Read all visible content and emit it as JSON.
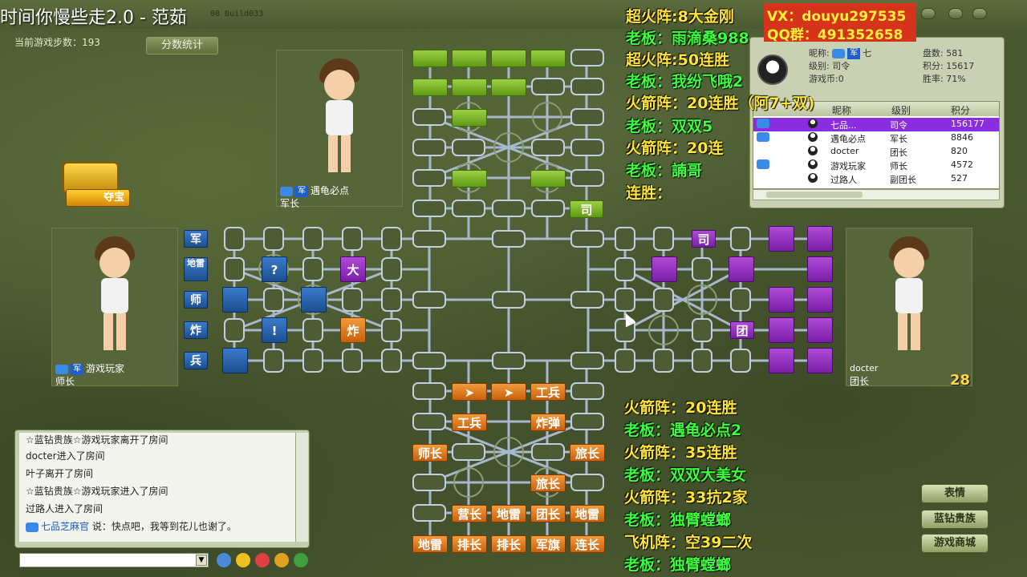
{
  "window": {
    "caption": "时间你慢些走2.0 - 范茹",
    "build": "08 Build033"
  },
  "game": {
    "steps_label": "当前游戏步数：193",
    "stats_button": "分数统计",
    "treasure_label": "夺宝",
    "countdown": "28"
  },
  "players": {
    "top": {
      "name": "遇龟必点",
      "rank": "军长",
      "army": "军"
    },
    "left": {
      "name": "游戏玩家",
      "rank": "师长",
      "army": "军"
    },
    "right": {
      "name": "docter",
      "rank": "团长"
    }
  },
  "board": {
    "left_pieces": [
      "军",
      "地雷",
      "师",
      "炸",
      "兵",
      "?",
      "大",
      "!",
      "炸"
    ],
    "top_piece": "司",
    "right_pieces": [
      "司",
      "团"
    ],
    "bottom_pieces": [
      "工兵",
      "工兵",
      "炸弹",
      "师长",
      "旅长",
      "旅长",
      "营长",
      "地雷",
      "团长",
      "地雷",
      "地雷",
      "排长",
      "排长",
      "军旗",
      "连长"
    ]
  },
  "info": {
    "nickname_label": "昵称:",
    "nickname": "七",
    "level_label": "级别:",
    "level": "司令",
    "coins_label": "游戏币:",
    "coins": "0",
    "games_label": "盘数:",
    "games": "581",
    "score_label": "积分:",
    "score": "15617",
    "winrate_label": "胜率:",
    "winrate": "71%",
    "columns": [
      "昵称",
      "级别",
      "积分"
    ],
    "rows": [
      {
        "name": "七品...",
        "level": "司令",
        "score": "156177"
      },
      {
        "name": "遇龟必点",
        "level": "军长",
        "score": "8846"
      },
      {
        "name": "docter",
        "level": "团长",
        "score": "820"
      },
      {
        "name": "游戏玩家",
        "level": "师长",
        "score": "4572"
      },
      {
        "name": "过路人",
        "level": "副团长",
        "score": "527"
      }
    ]
  },
  "overlay": {
    "vx": "VX：douyu297535",
    "qq": "QQ群：491352658",
    "top_lines": [
      "超火阵:8大金刚",
      "老板：雨滴桑988",
      "超火阵:50连胜",
      "老板：我纷飞哦2",
      "火箭阵：20连胜（阿7+双)",
      "老板：双双5",
      "火箭阵：20连",
      "老板：諵哥",
      "连胜："
    ],
    "bottom_lines": [
      "火箭阵：20连胜",
      "老板：遇龟必点2",
      "火箭阵：35连胜",
      "老板：双双大美女",
      "火箭阵：33抗2家",
      "老板：独臂螳螂",
      "飞机阵：空39二次",
      "老板：独臂螳螂"
    ]
  },
  "chat": {
    "lines": [
      {
        "text": "☆蓝钻贵族☆游戏玩家离开了房间"
      },
      {
        "text": "docter进入了房间"
      },
      {
        "text": "叶子离开了房间"
      },
      {
        "text": "☆蓝钻贵族☆游戏玩家进入了房间"
      },
      {
        "text": "过路人进入了房间"
      }
    ],
    "last_name": "七品芝麻官",
    "last_text": "说：快点吧，我等到花儿也谢了。"
  },
  "buttons": {
    "emotion": "表情",
    "blue_diamond": "蓝钻贵族",
    "shop": "游戏商城"
  },
  "colors": {
    "green": "#5e9a14",
    "purple": "#7a1ea8",
    "blue": "#1d4f90",
    "orange": "#c8600c"
  }
}
